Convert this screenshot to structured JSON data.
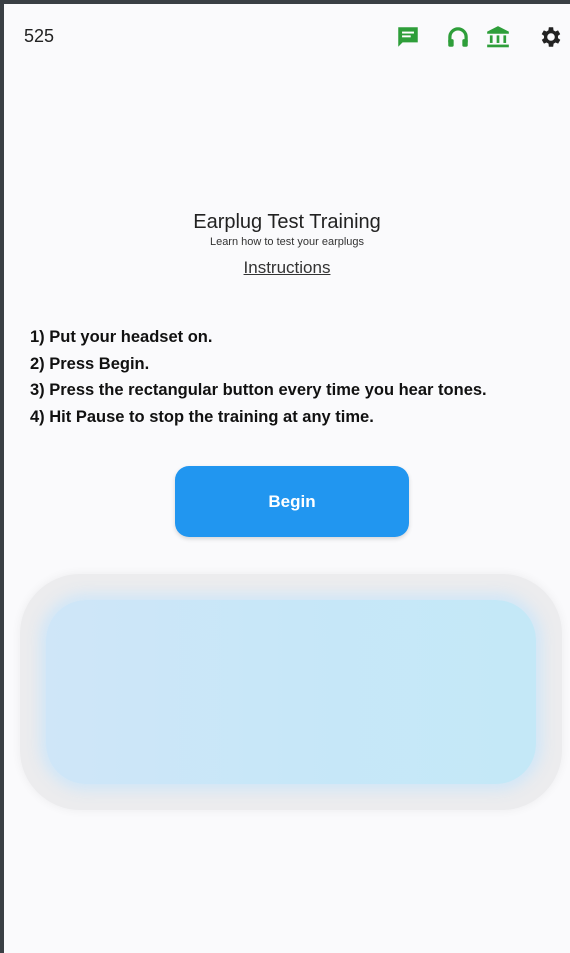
{
  "header": {
    "counter": "525",
    "icons": [
      "chat-icon",
      "headphones-icon",
      "bank-icon",
      "gear-icon"
    ],
    "icon_color": "#2e9e3a",
    "gear_color": "#222222"
  },
  "main": {
    "title": "Earplug Test Training",
    "subtitle": "Learn how to test your earplugs",
    "instructions_link": "Instructions",
    "steps": [
      "1) Put your headset on.",
      "2) Press Begin.",
      "3) Press the rectangular button every time you hear tones.",
      "4) Hit Pause to stop the training at any time."
    ],
    "begin_label": "Begin"
  },
  "colors": {
    "accent": "#2196f0",
    "tone_button": "#c8e6f8"
  }
}
